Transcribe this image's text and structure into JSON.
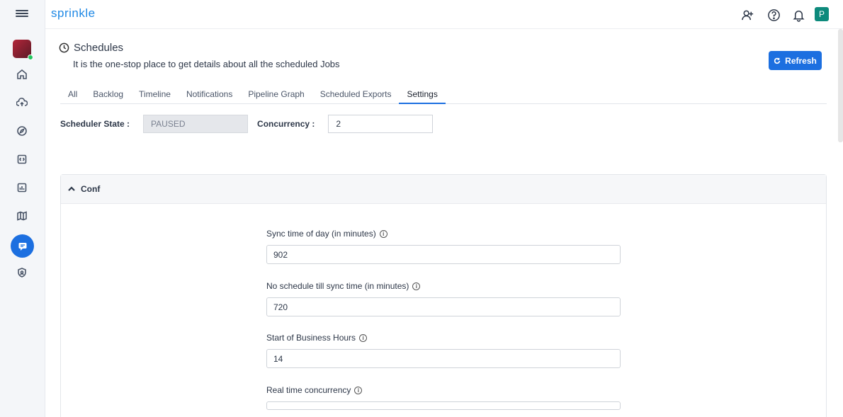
{
  "brand": {
    "name": "sprinkle"
  },
  "sidebar": {
    "items": [
      {
        "icon": "home-icon"
      },
      {
        "icon": "cloud-upload-icon"
      },
      {
        "icon": "compass-icon"
      },
      {
        "icon": "code-icon"
      },
      {
        "icon": "chart-icon"
      },
      {
        "icon": "map-icon"
      },
      {
        "icon": "chat-icon",
        "active": true
      },
      {
        "icon": "shield-icon"
      }
    ]
  },
  "header": {
    "user_initial": "P",
    "icons": [
      "add-user-icon",
      "help-icon",
      "bell-icon"
    ]
  },
  "page": {
    "title": "Schedules",
    "subtitle": "It is the one-stop place to get details about all the scheduled Jobs",
    "refresh_label": "Refresh"
  },
  "tabs": [
    "All",
    "Backlog",
    "Timeline",
    "Notifications",
    "Pipeline Graph",
    "Scheduled Exports",
    "Settings"
  ],
  "active_tab": "Settings",
  "settings": {
    "state_label": "Scheduler State :",
    "state_value": "PAUSED",
    "concurrency_label": "Concurrency :",
    "concurrency_value": "2"
  },
  "conf": {
    "title": "Conf",
    "fields": [
      {
        "label": "Sync time of day (in minutes)",
        "value": "902"
      },
      {
        "label": "No schedule till sync time (in minutes)",
        "value": "720"
      },
      {
        "label": "Start of Business Hours",
        "value": "14"
      },
      {
        "label": "Real time concurrency",
        "value": ""
      }
    ]
  },
  "colors": {
    "accent": "#1c6fe0",
    "brand": "#1e88e5",
    "user_badge": "#0d8a7c"
  }
}
